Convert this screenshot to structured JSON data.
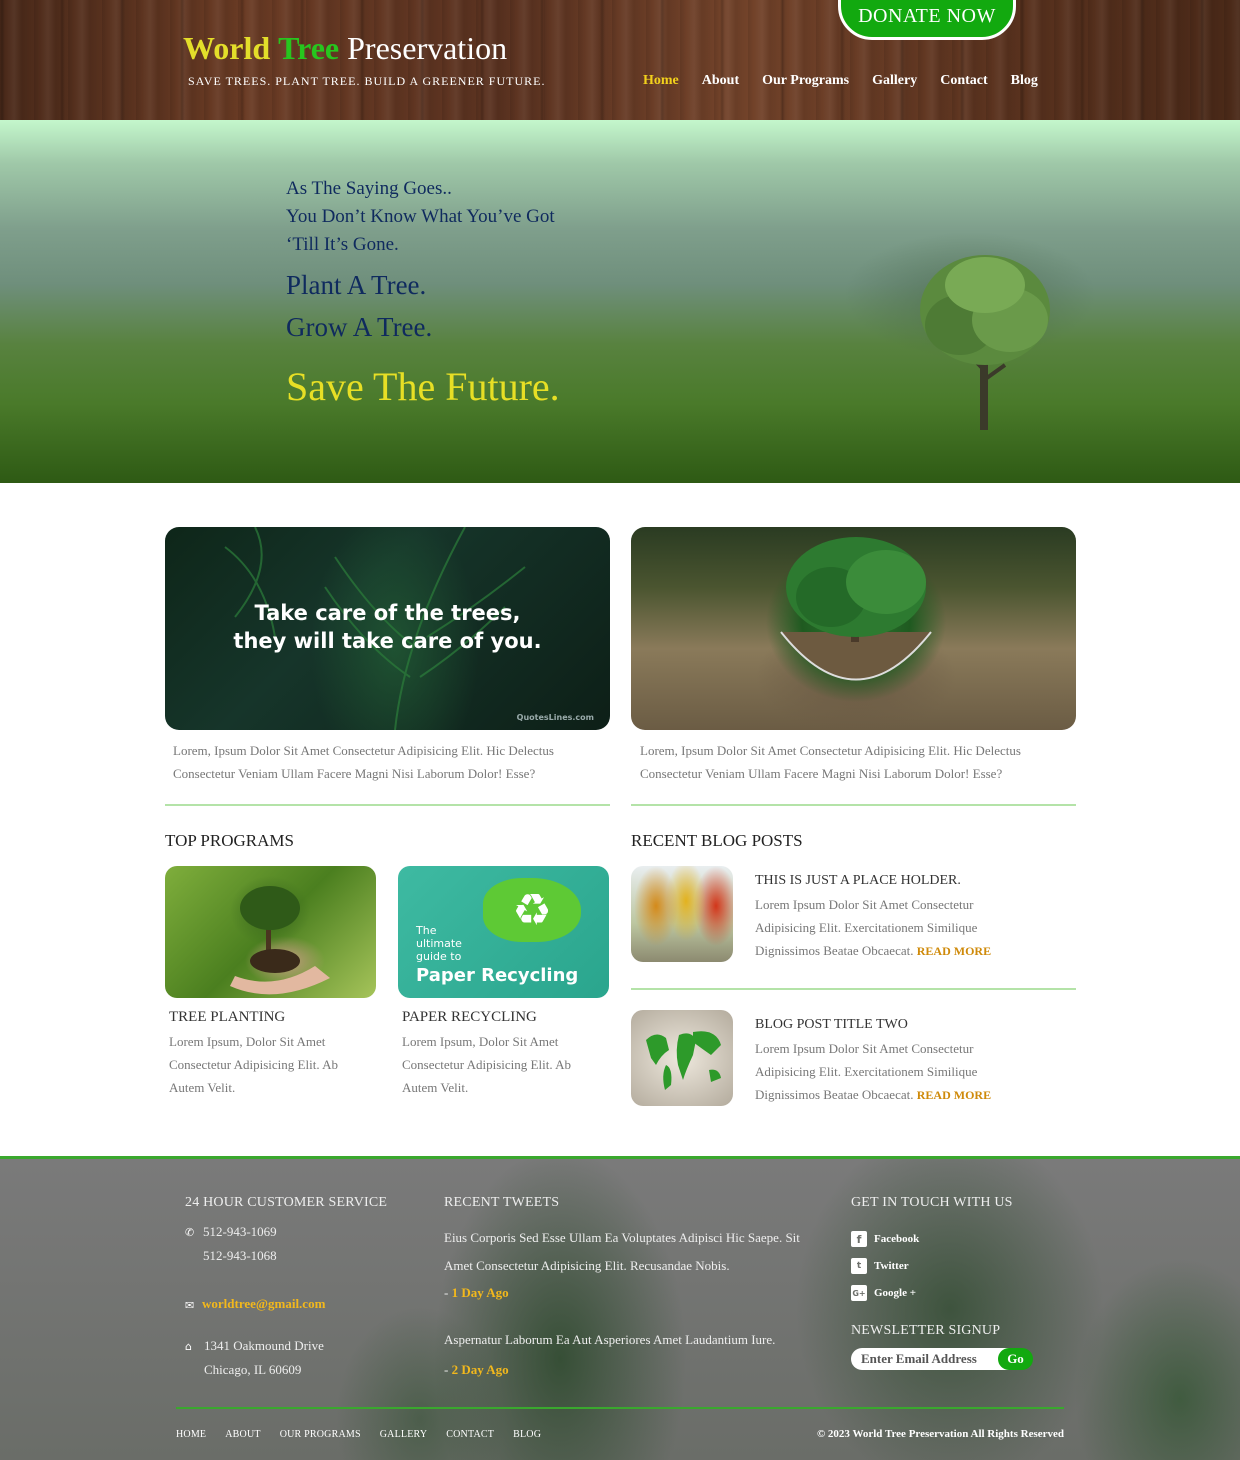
{
  "header": {
    "logo_word1": "World",
    "logo_word2": "Tree",
    "logo_word3": "Preservation",
    "tagline": "Save Trees. Plant Tree. Build A Greener Future.",
    "donate_label": "DONATE NOW",
    "nav": [
      "Home",
      "About",
      "Our Programs",
      "Gallery",
      "Contact",
      "Blog"
    ],
    "active_nav": "Home"
  },
  "hero": {
    "line1": "As The Saying Goes..",
    "line2": "You Don’t Know What You’ve Got",
    "line3": "‘Till It’s Gone.",
    "big1": "Plant A Tree.",
    "big2": "Grow A Tree.",
    "save": "Save The Future."
  },
  "features": [
    {
      "quote_line1": "Take care of the trees,",
      "quote_line2": "they will take care of you.",
      "watermark": "QuotesLines.com",
      "text": "Lorem, Ipsum Dolor Sit Amet Consectetur Adipisicing Elit. Hic Delectus Consectetur Veniam Ullam Facere Magni Nisi Laborum Dolor! Esse?"
    },
    {
      "text": "Lorem, Ipsum Dolor Sit Amet Consectetur Adipisicing Elit. Hic Delectus Consectetur Veniam Ullam Facere Magni Nisi Laborum Dolor! Esse?"
    }
  ],
  "programs": {
    "title": "Top Programs",
    "items": [
      {
        "name": "Tree Planting",
        "desc": "Lorem Ipsum, Dolor Sit Amet Consectetur Adipisicing Elit. Ab Autem Velit."
      },
      {
        "name": "Paper Recycling",
        "desc": "Lorem Ipsum, Dolor Sit Amet Consectetur Adipisicing Elit. Ab Autem Velit.",
        "img_small": "The ultimate guide to",
        "img_big": "Paper Recycling"
      }
    ]
  },
  "blog": {
    "title": "Recent Blog Posts",
    "read_more": "Read More",
    "posts": [
      {
        "title": "This Is Just A Place Holder.",
        "desc": "Lorem Ipsum Dolor Sit Amet Consectetur Adipisicing Elit. Exercitationem Similique Dignissimos Beatae Obcaecat."
      },
      {
        "title": "Blog Post Title Two",
        "desc": "Lorem Ipsum Dolor Sit Amet Consectetur Adipisicing Elit. Exercitationem Similique Dignissimos Beatae Obcaecat."
      }
    ]
  },
  "footer": {
    "service_title": "24 Hour Customer Service",
    "phone1": "512-943-1069",
    "phone2": "512-943-1068",
    "email": "worldtree@gmail.com",
    "address1": "1341 Oakmound Drive",
    "address2": "Chicago, IL 60609",
    "tweets_title": "Recent Tweets",
    "tweet1": "Eius Corporis Sed Esse Ullam Ea Voluptates Adipisci Hic Saepe. Sit Amet Consectetur Adipisicing Elit. Recusandae Nobis.",
    "tweet1_ago": "1 Day Ago",
    "tweet2": "Aspernatur Laborum Ea Aut Asperiores Amet Laudantium Iure.",
    "tweet2_ago": "2 Day Ago",
    "touch_title": "Get In Touch With Us",
    "social": [
      "Facebook",
      "Twitter",
      "Google +"
    ],
    "newsletter_title": "Newsletter Signup",
    "newsletter_placeholder": "Enter Email Address",
    "newsletter_button": "Go",
    "nav": [
      "Home",
      "About",
      "Our Programs",
      "Gallery",
      "Contact",
      "Blog"
    ],
    "copyright": "© 2023 World Tree Preservation All Rights Reserved"
  },
  "colors": {
    "brand_green": "#12a90f",
    "logo_yellow": "#e3de2a",
    "nav_active": "#f2d11c",
    "link_orange": "#cf8a0a",
    "footer_link": "#f2b81c"
  }
}
